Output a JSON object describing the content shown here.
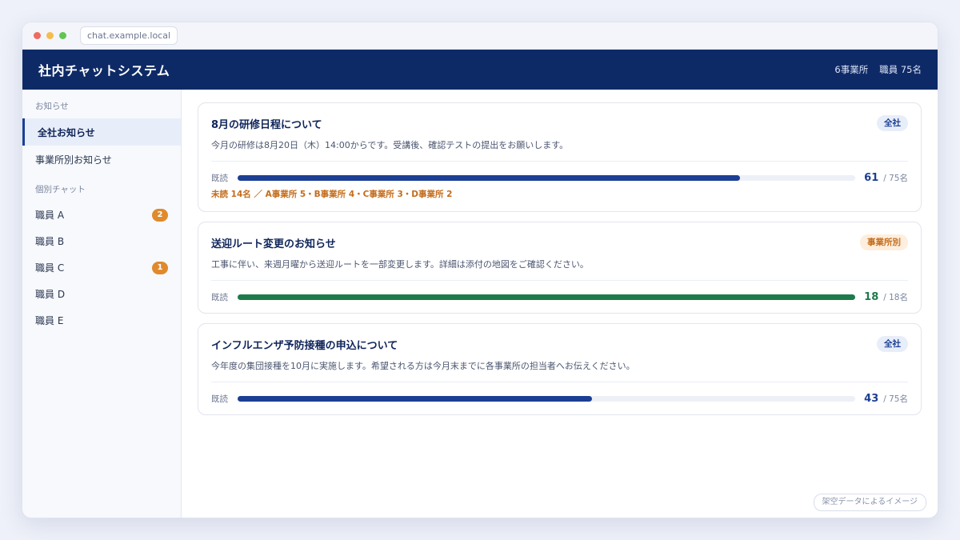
{
  "browser": {
    "url": "chat.example.local"
  },
  "header": {
    "title": "社内チャットシステム",
    "offices": "6事業所",
    "staff": "職員 75名"
  },
  "sidebar": {
    "section_notices": "お知らせ",
    "notices": [
      {
        "label": "全社お知らせ",
        "active": true
      },
      {
        "label": "事業所別お知らせ",
        "active": false
      }
    ],
    "section_chats": "個別チャット",
    "chats": [
      {
        "label": "職員 A",
        "badge": "2"
      },
      {
        "label": "職員 B",
        "badge": ""
      },
      {
        "label": "職員 C",
        "badge": "1"
      },
      {
        "label": "職員 D",
        "badge": ""
      },
      {
        "label": "職員 E",
        "badge": ""
      }
    ]
  },
  "colors": {
    "primary": "#0e2a66",
    "read_blue": "#1c3f94",
    "read_green": "#1e7a4c",
    "accent_orange": "#e08a2c"
  },
  "announcements": [
    {
      "title": "8月の研修日程について",
      "tag": "全社",
      "body": "今月の研修は8月20日（木）14:00からです。受講後、確認テストの提出をお願いします。",
      "read_label": "既読",
      "read": 61,
      "total": 75,
      "read_text": "61",
      "total_text": "/ 75名",
      "unread": "未読 14名 ／ A事業所 5・B事業所 4・C事業所 3・D事業所 2"
    },
    {
      "title": "送迎ルート変更のお知らせ",
      "tag": "事業所別",
      "body": "工事に伴い、来週月曜から送迎ルートを一部変更します。詳細は添付の地図をご確認ください。",
      "read_label": "既読",
      "read": 18,
      "total": 18,
      "read_text": "18",
      "total_text": "/ 18名",
      "unread": ""
    },
    {
      "title": "インフルエンザ予防接種の申込について",
      "tag": "全社",
      "body": "今年度の集団接種を10月に実施します。希望される方は今月末までに各事業所の担当者へお伝えください。",
      "read_label": "既読",
      "read": 43,
      "total": 75,
      "read_text": "43",
      "total_text": "/ 75名",
      "unread": ""
    }
  ],
  "footer": {
    "note": "架空データによるイメージ"
  }
}
